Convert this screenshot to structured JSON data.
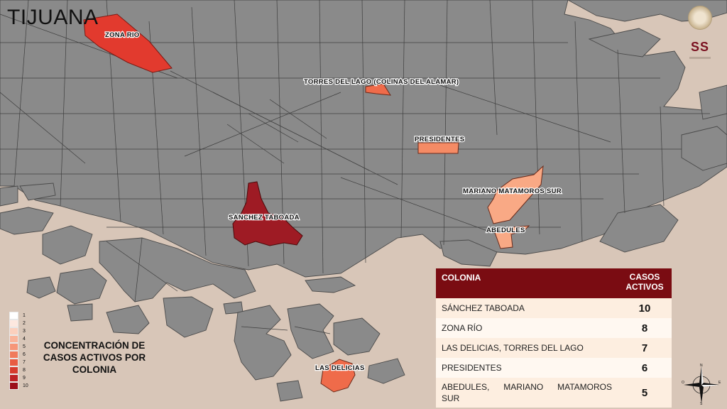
{
  "title": "TIJUANA",
  "logo": {
    "text": "SS"
  },
  "colors": {
    "background": "#d8c6b8",
    "block_fill": "#8a8a8a",
    "block_stroke": "#4a4a4a",
    "table_header": "#7a0c12",
    "cases_10": "#9e1b24",
    "cases_8": "#e23a2e",
    "cases_7": "#ef6b4a",
    "cases_6": "#f58b65",
    "cases_5": "#f9a985"
  },
  "map_labels": {
    "zona_rio": "ZONA RIO",
    "torres_del_lago": "TORRES DEL LAGO (COLINAS DEL ALAMAR)",
    "presidentes": "PRESIDENTES",
    "mariano_matamoros": "MARIANO MATAMOROS SUR",
    "sanchez_taboada": "SANCHEZ TABOADA",
    "abedules": "ABEDULES",
    "las_delicias": "LAS DELICIAS"
  },
  "legend": {
    "title": "CONCENTRACIÓN DE CASOS ACTIVOS POR COLONIA",
    "classes": [
      {
        "label": "1",
        "color": "#ffffff"
      },
      {
        "label": "2",
        "color": "#fde8df"
      },
      {
        "label": "3",
        "color": "#fbd0bd"
      },
      {
        "label": "4",
        "color": "#f9b49a"
      },
      {
        "label": "5",
        "color": "#f69678"
      },
      {
        "label": "6",
        "color": "#f07a5c"
      },
      {
        "label": "7",
        "color": "#e85b42"
      },
      {
        "label": "8",
        "color": "#d63b2e"
      },
      {
        "label": "9",
        "color": "#bd2226"
      },
      {
        "label": "10",
        "color": "#9b0f1c"
      }
    ]
  },
  "table": {
    "headers": {
      "colonia": "COLONIA",
      "casos": "CASOS ACTIVOS"
    },
    "rows": [
      {
        "colonia": "SÁNCHEZ TABOADA",
        "casos": "10"
      },
      {
        "colonia": "ZONA RÍO",
        "casos": "8"
      },
      {
        "colonia": "LAS DELICIAS, TORRES DEL LAGO",
        "casos": "7"
      },
      {
        "colonia": "PRESIDENTES",
        "casos": "6"
      },
      {
        "colonia_line1": "ABEDULES, MARIANO MATAMOROS",
        "colonia_line2": "SUR",
        "casos": "5"
      }
    ]
  },
  "compass": {
    "north": "N",
    "south": "S",
    "east": "E",
    "west": "O"
  }
}
